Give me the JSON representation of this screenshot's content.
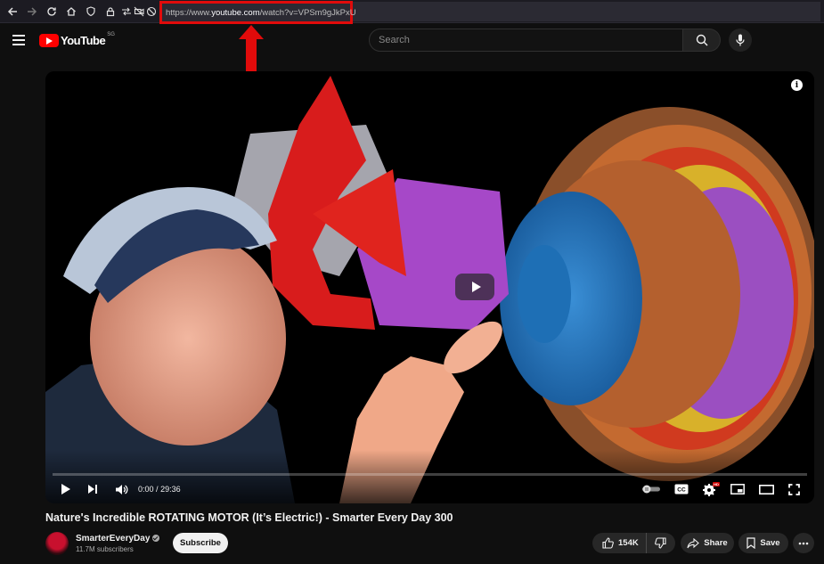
{
  "browser": {
    "url_prefix": "https://www.",
    "url_domain": "youtube.com",
    "url_path": "/watch?v=VPSm9gJkPxU",
    "icons": [
      "back-icon",
      "forward-icon",
      "reload-icon",
      "home-icon",
      "shield-icon",
      "lock-icon",
      "permissions-icon",
      "camera-off-icon",
      "mic-off-icon"
    ],
    "highlight_color": "#e10b0b"
  },
  "header": {
    "logo_text": "YouTube",
    "country_code": "SG",
    "search_placeholder": "Search",
    "brand_color": "#ff0000"
  },
  "player": {
    "current_time": "0:00",
    "time_separator": "/",
    "duration": "29:36",
    "progress_fraction": 0,
    "hd_badge": "HD",
    "info_symbol": "i"
  },
  "video": {
    "title": "Nature's Incredible ROTATING MOTOR (It’s Electric!) - Smarter Every Day 300"
  },
  "channel": {
    "name": "SmarterEveryDay",
    "subscribers": "11.7M subscribers",
    "subscribe_label": "Subscribe"
  },
  "actions": {
    "likes": "154K",
    "share_label": "Share",
    "save_label": "Save"
  }
}
